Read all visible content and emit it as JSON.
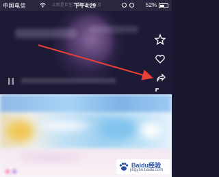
{
  "status_bar": {
    "carrier": "中国电信",
    "time": "下午4:29",
    "watermark": "上新是巨生活要有你的支持",
    "battery": "52%"
  },
  "video": {
    "side_icons": [
      "star-icon",
      "heart-icon",
      "fullscreen-icon"
    ]
  },
  "annotation": {
    "arrow_color": "#e8413a"
  },
  "watermark_logo": {
    "brand": "Baidu经验",
    "domain": "jingyan.baidu.com"
  }
}
